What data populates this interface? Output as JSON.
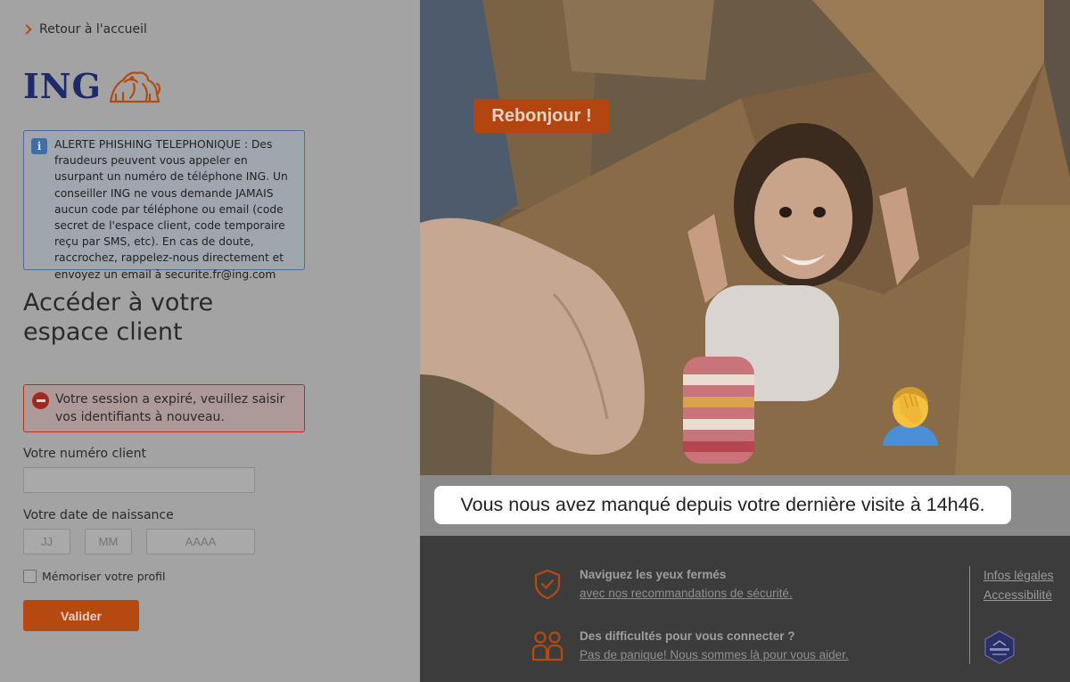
{
  "back_link": {
    "label": "Retour à l'accueil"
  },
  "logo": {
    "text": "ING"
  },
  "phishing_alert": {
    "text": "ALERTE PHISHING TELEPHONIQUE : Des fraudeurs peuvent vous appeler en usurpant un numéro de téléphone ING. Un conseiller ING ne vous demande JAMAIS aucun code par téléphone ou email (code secret de l'espace client, code temporaire reçu par SMS, etc). En cas de doute, raccrochez, rappelez-nous directement et envoyez un email à securite.fr@ing.com"
  },
  "login": {
    "heading_line1": "Accéder à votre",
    "heading_line2": "espace client",
    "session_error": "Votre session a expiré, veuillez saisir vos identifiants à nouveau.",
    "client_number_label": "Votre numéro client",
    "client_number_value": "",
    "birthdate_label": "Votre date de naissance",
    "day_placeholder": "JJ",
    "month_placeholder": "MM",
    "year_placeholder": "AAAA",
    "remember_label": "Mémoriser votre profil",
    "remember_checked": false,
    "submit_label": "Valider"
  },
  "hero": {
    "greeting": "Rebonjour !",
    "emoji": "facepalm-emoji",
    "caption": "Vous nous avez manqué depuis votre dernière visite à 14h46."
  },
  "footer": {
    "security": {
      "title": "Naviguez les yeux fermés",
      "link": "avec nos recommandations de sécurité."
    },
    "help": {
      "title": "Des difficultés pour vous connecter ?",
      "link": "Pas de panique! Nous sommes là pour vous aider."
    },
    "legal_links": [
      "Infos légales",
      "Accessibilité"
    ],
    "badge": "entrust-verified-badge"
  },
  "colors": {
    "brand_orange": "#b54a10",
    "ing_blue": "#1f2a6b",
    "error_red": "#b23127"
  }
}
